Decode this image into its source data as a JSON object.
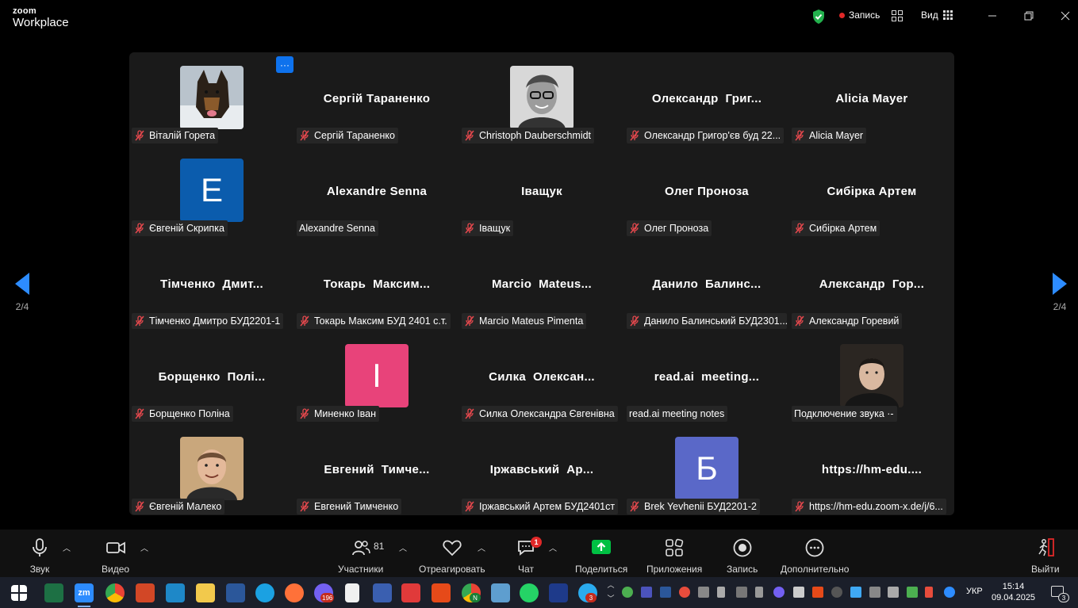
{
  "app": {
    "logo_top": "zoom",
    "logo_bottom": "Workplace",
    "record_label": "Запись",
    "view_label": "Вид",
    "brand_color": "#0e72ed",
    "shield_color": "#23b14d"
  },
  "gallery": {
    "page_left": "2/4",
    "page_right": "2/4",
    "more_label": "···",
    "tiles": [
      {
        "label": "Віталій Горета",
        "center": "",
        "avatar": "photo-dog",
        "muted": true
      },
      {
        "label": "Сергій Тараненко",
        "center": "Сергій Тараненко",
        "muted": true
      },
      {
        "label": "Christoph Dauberschmidt",
        "center": "",
        "avatar": "photo-man-glasses",
        "muted": true
      },
      {
        "label": "Олександр Григор'єв буд 22...",
        "center": "Олександр  Григ...",
        "muted": true
      },
      {
        "label": "Alicia Mayer",
        "center": "Alicia Mayer",
        "muted": true
      },
      {
        "label": "Євгеній Скрипка",
        "center": "",
        "letter": "Е",
        "letter_color": "#0b5cad",
        "muted": true
      },
      {
        "label": "Alexandre Senna",
        "center": "Alexandre Senna",
        "muted": false
      },
      {
        "label": "Іващук",
        "center": "Іващук",
        "muted": true
      },
      {
        "label": "Олег Проноза",
        "center": "Олег Проноза",
        "muted": true
      },
      {
        "label": "Сибірка Артем",
        "center": "Сибірка Артем",
        "muted": true
      },
      {
        "label": "Тімченко Дмитро БУД2201-1",
        "center": "Тімченко  Дмит...",
        "muted": true
      },
      {
        "label": "Токарь Максим БУД 2401 с.т.",
        "center": "Токарь  Максим...",
        "muted": true
      },
      {
        "label": "Marcio Mateus Pimenta",
        "center": "Marcio  Mateus...",
        "muted": true
      },
      {
        "label": "Данило Балинський БУД2301...",
        "center": "Данило  Балинс...",
        "muted": true
      },
      {
        "label": "Александр Горевий",
        "center": "Александр  Гор...",
        "muted": true
      },
      {
        "label": "Борщенко Поліна",
        "center": "Борщенко  Полі...",
        "muted": true
      },
      {
        "label": "Миненко Іван",
        "center": "",
        "letter": "І",
        "letter_color": "#e8437a",
        "muted": true
      },
      {
        "label": "Силка Олександра Євгенівна",
        "center": "Силка  Олексан...",
        "muted": true
      },
      {
        "label": "read.ai meeting notes",
        "center": "read.ai  meeting...",
        "muted": false
      },
      {
        "label": "Подключение звука ·-",
        "center": "",
        "avatar": "photo-man-hoodie",
        "muted": false
      },
      {
        "label": "Євгеній Малеко",
        "center": "",
        "avatar": "photo-man-bald",
        "muted": true
      },
      {
        "label": "Евгений Тимченко",
        "center": "Евгений  Тимче...",
        "muted": true
      },
      {
        "label": "Іржавський Артем БУД2401ст",
        "center": "Іржавський  Ар...",
        "muted": true
      },
      {
        "label": "Brek Yevhenii БУД2201-2",
        "center": "",
        "letter": "Б",
        "letter_color": "#5a68c8",
        "muted": true
      },
      {
        "label": "https://hm-edu.zoom-x.de/j/6...",
        "center": "https://hm-edu....",
        "muted": true
      }
    ]
  },
  "toolbar": {
    "audio": "Звук",
    "video": "Видео",
    "participants": "Участники",
    "participants_count": "81",
    "react": "Отреагировать",
    "chat": "Чат",
    "chat_badge": "1",
    "share": "Поделиться",
    "apps": "Приложения",
    "record": "Запись",
    "more": "Дополнительно",
    "leave": "Выйти"
  },
  "taskbar": {
    "viber_badge": "196",
    "chrome_badge": "N",
    "telegram_badge": "3",
    "lang": "УКР",
    "time": "15:14",
    "date": "09.04.2025",
    "notif_count": "3"
  }
}
